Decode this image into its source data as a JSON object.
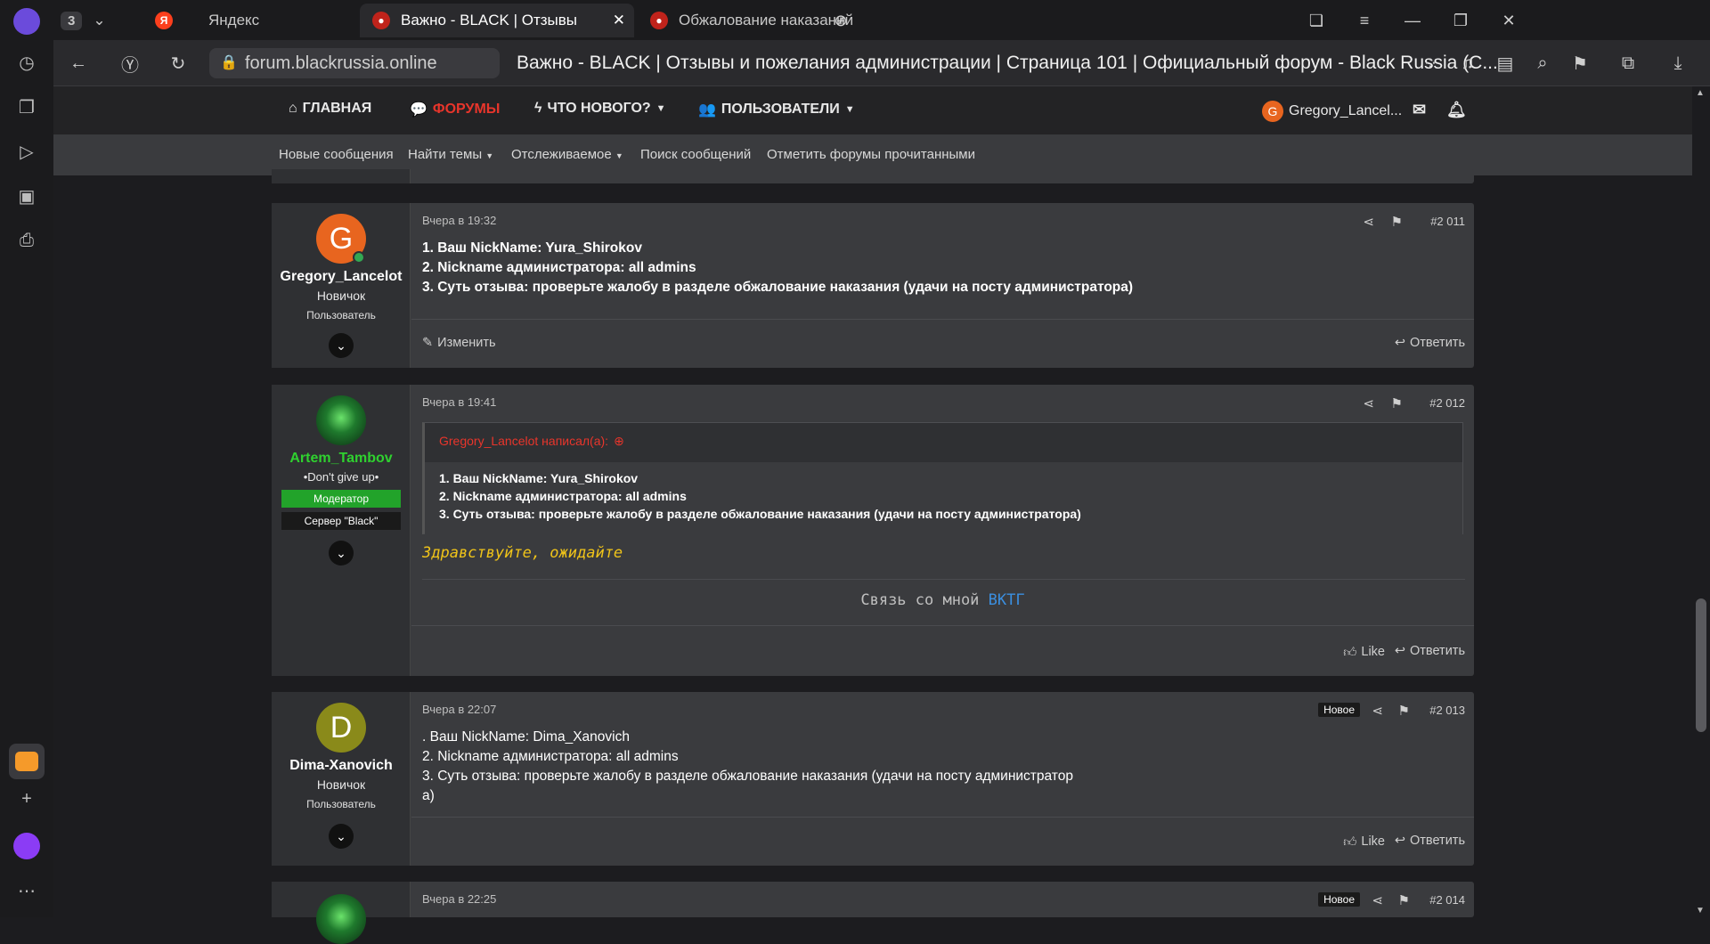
{
  "browser": {
    "tab_counter": "3",
    "tabs": [
      {
        "label": "Яндекс"
      },
      {
        "label": "Важно - BLACK | Отзывы"
      },
      {
        "label": "Обжалование наказаний"
      }
    ],
    "url": "forum.blackrussia.online",
    "page_title": "Важно - BLACK | Отзывы и пожелания администрации | Страница 101 | Официальный форум - Black Russia (C..."
  },
  "nav": {
    "home": "ГЛАВНАЯ",
    "forums": "ФОРУМЫ",
    "whats_new": "ЧТО НОВОГО?",
    "users": "ПОЛЬЗОВАТЕЛИ",
    "account_initial": "G",
    "account_name": "Gregory_Lancel..."
  },
  "subnav": {
    "new_posts": "Новые сообщения",
    "find_threads": "Найти темы",
    "watched": "Отслеживаемое",
    "search_posts": "Поиск сообщений",
    "mark_read": "Отметить форумы прочитанными"
  },
  "posts": [
    {
      "initial": "G",
      "avatar_color": "#e8651f",
      "username": "Gregory_Lancelot",
      "title": "Новичок",
      "role": "Пользователь",
      "date": "Вчера в 19:32",
      "number": "#2 011",
      "lines": [
        "1. Ваш NickName: Yura_Shirokov",
        "2. Nickname администратора: all admins",
        "3. Суть отзыва: проверьте жалобу в разделе обжалование наказания (удачи на посту администратора)"
      ],
      "edit": "Изменить",
      "reply": "Ответить"
    },
    {
      "username": "Artem_Tambov",
      "title": "•Don't give up•",
      "badge_moderator": "Модератор",
      "badge_server": "Сервер \"Black\"",
      "date": "Вчера в 19:41",
      "number": "#2 012",
      "quote_author": "Gregory_Lancelot написал(а):",
      "quote_lines": [
        "1. Ваш NickName: Yura_Shirokov",
        "2. Nickname администратора: all admins",
        "3. Суть отзыва: проверьте жалобу в разделе обжалование наказания (удачи на посту администратора)"
      ],
      "greeting": "Здравствуйте, ожидайте",
      "signature_text": "Связь со мной",
      "signature_vk": "ВК",
      "signature_tg": "ТГ",
      "like": "Like",
      "reply": "Ответить"
    },
    {
      "initial": "D",
      "avatar_color": "#8a8a1a",
      "username": "Dima-Xanovich",
      "title": "Новичок",
      "role": "Пользователь",
      "date": "Вчера в 22:07",
      "badge_new": "Новое",
      "number": "#2 013",
      "lines": [
        ". Ваш NickName: Dima_Xanovich",
        "2. Nickname администратора: all admins",
        "3. Суть отзыва: проверьте жалобу в разделе обжалование наказания (удачи на посту администратор",
        "а)"
      ],
      "like": "Like",
      "reply": "Ответить"
    },
    {
      "date": "Вчера в 22:25",
      "badge_new": "Новое",
      "number": "#2 014"
    }
  ]
}
